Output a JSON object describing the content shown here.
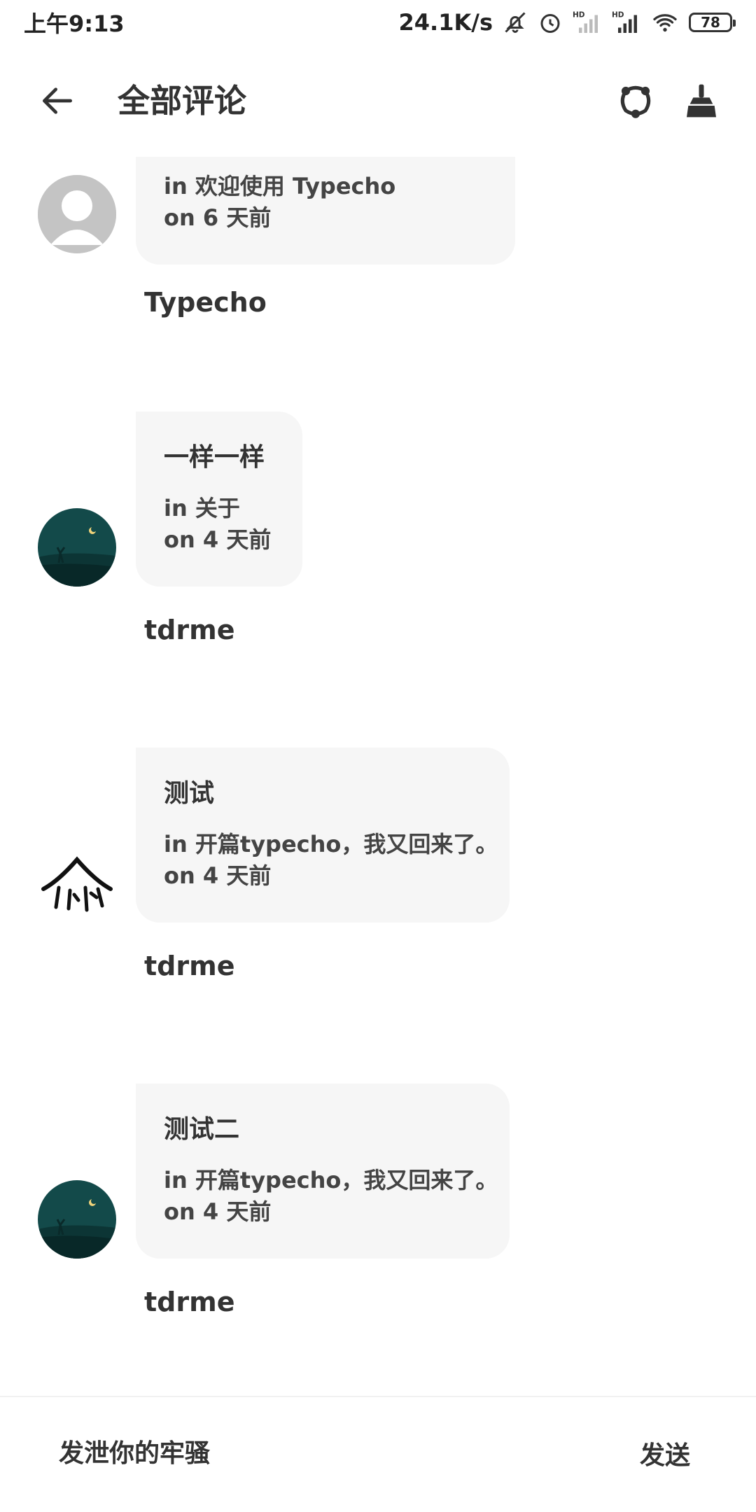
{
  "status_bar": {
    "time": "上午9:13",
    "net_speed": "24.1K/s",
    "battery": "78",
    "icons": [
      "mute-bell-icon",
      "alarm-icon",
      "hd-signal-icon",
      "hd-signal-icon",
      "wifi-icon",
      "battery-icon"
    ]
  },
  "app_bar": {
    "title": "全部评论",
    "back_icon": "arrow-left-icon",
    "actions": [
      "connection-icon",
      "broom-icon"
    ]
  },
  "comments": [
    {
      "content": "",
      "post": "in 欢迎使用 Typecho",
      "time": "on 6 天前",
      "author": "Typecho",
      "avatar": "default-avatar"
    },
    {
      "content": "一样一样",
      "post": "in 关于",
      "time": "on 4 天前",
      "author": "tdrme",
      "avatar": "night-deer-avatar"
    },
    {
      "content": "测试",
      "post": "in 开篇typecho，我又回来了。",
      "time": "on 4 天前",
      "author": "tdrme",
      "avatar": "calligraphy-logo-avatar"
    },
    {
      "content": "测试二",
      "post": "in 开篇typecho，我又回来了。",
      "time": "on 4 天前",
      "author": "tdrme",
      "avatar": "night-deer-avatar"
    }
  ],
  "composer": {
    "placeholder": "发泄你的牢骚",
    "send_label": "发送"
  },
  "colors": {
    "bubble_bg": "#f6f6f6",
    "text": "#333333",
    "avatar_dark_teal": "#134a4a"
  }
}
